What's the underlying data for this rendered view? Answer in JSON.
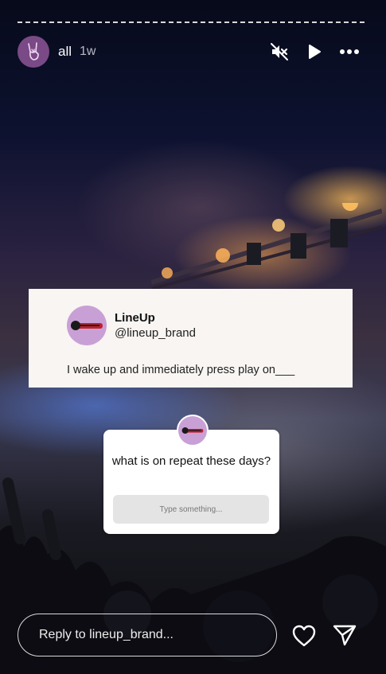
{
  "story": {
    "username": "all",
    "time_ago": "1w",
    "avatar_icon": "rock-hand-icon",
    "controls": {
      "mute_icon": "muted-speaker-icon",
      "play_icon": "play-icon",
      "more_icon": "more-options-icon"
    }
  },
  "post_card": {
    "brand_name": "LineUp",
    "brand_handle": "@lineup_brand",
    "brand_logo_icon": "guitar-logo-icon",
    "text": "I wake up and immediately press play on___"
  },
  "question_box": {
    "question": "what is on repeat these days?",
    "input_placeholder": "Type something..."
  },
  "reply": {
    "placeholder": "Reply to lineup_brand...",
    "like_icon": "heart-icon",
    "send_icon": "send-icon"
  },
  "colors": {
    "card_bg": "#f8f5f2",
    "avatar_bg": "#7a4a86",
    "brand_avatar_bg": "#c9a0d6"
  }
}
